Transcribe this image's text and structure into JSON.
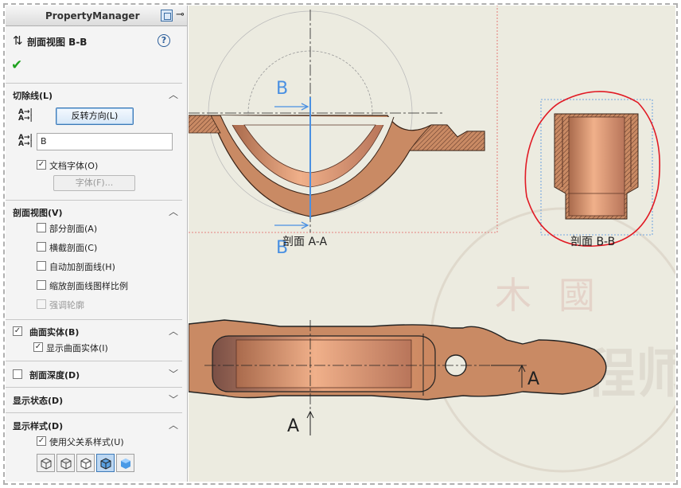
{
  "panel": {
    "title": "PropertyManager",
    "feature_name": "剖面视图 B-B",
    "sections": {
      "cutline": {
        "label": "切除线(L)",
        "reverse_button": "反转方向(L)",
        "label_value": "B",
        "doc_font_label": "文档字体(O)",
        "doc_font_checked": true,
        "font_button": "字体(F)..."
      },
      "section_view": {
        "label": "剖面视图(V)",
        "options": [
          {
            "label": "部分剖面(A)",
            "checked": false,
            "enabled": true
          },
          {
            "label": "横截剖面(C)",
            "checked": false,
            "enabled": true
          },
          {
            "label": "自动加剖面线(H)",
            "checked": false,
            "enabled": true
          },
          {
            "label": "缩放剖面线图样比例",
            "checked": false,
            "enabled": true
          },
          {
            "label": "强调轮廓",
            "checked": false,
            "enabled": false
          }
        ]
      },
      "surface_bodies": {
        "label": "曲面实体(B)",
        "checked": true,
        "show_label": "显示曲面实体(I)",
        "show_checked": true
      },
      "section_depth": {
        "label": "剖面深度(D)",
        "checked": false
      },
      "display_state": {
        "label": "显示状态(D)"
      },
      "display_style": {
        "label": "显示样式(D)",
        "use_parent_label": "使用父关系样式(U)",
        "use_parent_checked": true
      }
    }
  },
  "drawing": {
    "view_aa_label": "剖面 A-A",
    "view_bb_label": "剖面 B-B",
    "letter_a": "A",
    "letter_b": "B",
    "colors": {
      "sheet": "#ecebe0",
      "copper": "#c98a64",
      "annotation_red": "#e11a24",
      "section_blue": "#4a90e2"
    }
  }
}
